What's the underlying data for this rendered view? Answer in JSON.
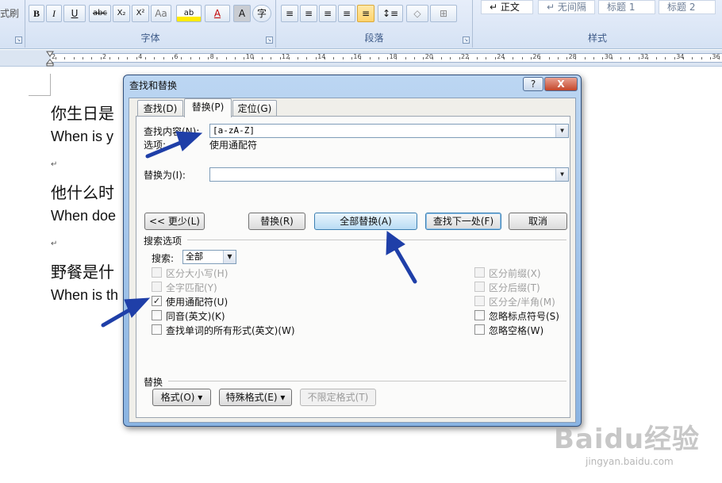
{
  "ribbon": {
    "clipboard_tail": "式刷",
    "font_group_label": "字体",
    "paragraph_group_label": "段落",
    "styles_group_label": "样式",
    "font_buttons": [
      "B",
      "I",
      "U",
      "abc",
      "X₂",
      "X²",
      "Aa",
      "ab",
      "A",
      "A",
      "字"
    ],
    "styles": [
      "↵ 正文",
      "↵ 无间隔",
      "标题 1",
      "标题 2"
    ]
  },
  "ruler": {
    "labels": [
      "2",
      "2",
      "4",
      "6",
      "8",
      "10",
      "12",
      "14",
      "16",
      "18",
      "20",
      "22",
      "24",
      "26",
      "28",
      "30",
      "32",
      "34",
      "36"
    ]
  },
  "document": {
    "lines": [
      {
        "kind": "cn",
        "text": "你生日是"
      },
      {
        "kind": "en",
        "text": "When is y"
      },
      {
        "kind": "mark",
        "text": "↵"
      },
      {
        "kind": "cn",
        "text": "他什么时"
      },
      {
        "kind": "en",
        "text": "When doe"
      },
      {
        "kind": "mark",
        "text": "↵"
      },
      {
        "kind": "cn",
        "text": "野餐是什"
      },
      {
        "kind": "en",
        "text": "When is th"
      }
    ]
  },
  "dialog": {
    "title": "查找和替换",
    "help": "?",
    "close": "X",
    "tabs": [
      "查找(D)",
      "替换(P)",
      "定位(G)"
    ],
    "find_label": "查找内容(N):",
    "find_value": "[a-zA-Z]",
    "options_label": "选项:",
    "options_value": "使用通配符",
    "replace_label": "替换为(I):",
    "replace_value": "",
    "buttons": {
      "less": "<< 更少(L)",
      "replace": "替换(R)",
      "replace_all": "全部替换(A)",
      "find_next": "查找下一处(F)",
      "cancel": "取消"
    },
    "search_options_label": "搜索选项",
    "search_label": "搜索:",
    "search_value": "全部",
    "left_options": [
      {
        "label": "区分大小写(H)",
        "checked": false,
        "enabled": false
      },
      {
        "label": "全字匹配(Y)",
        "checked": false,
        "enabled": false
      },
      {
        "label": "使用通配符(U)",
        "checked": true,
        "enabled": true
      },
      {
        "label": "同音(英文)(K)",
        "checked": false,
        "enabled": true
      },
      {
        "label": "查找单词的所有形式(英文)(W)",
        "checked": false,
        "enabled": true
      }
    ],
    "right_options": [
      {
        "label": "区分前缀(X)",
        "checked": false,
        "enabled": false
      },
      {
        "label": "区分后缀(T)",
        "checked": false,
        "enabled": false
      },
      {
        "label": "区分全/半角(M)",
        "checked": false,
        "enabled": false
      },
      {
        "label": "忽略标点符号(S)",
        "checked": false,
        "enabled": true
      },
      {
        "label": "忽略空格(W)",
        "checked": false,
        "enabled": true
      }
    ],
    "replace_section_label": "替换",
    "format_button": "格式(O) ▾",
    "special_button": "特殊格式(E) ▾",
    "no_format_button": "不限定格式(T)"
  },
  "watermark": {
    "logo": "Baidu经验",
    "url": "jingyan.baidu.com"
  },
  "colors": {
    "arrow": "#1f3fa8",
    "dialog_frame": "#8ab4e2"
  }
}
